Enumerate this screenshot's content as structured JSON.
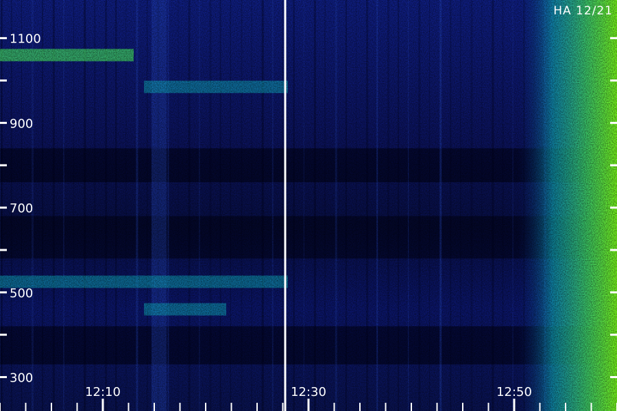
{
  "badge": "HA 12/21",
  "chart_data": {
    "type": "heatmap",
    "title": "",
    "xlabel": "",
    "ylabel": "",
    "x_ticks": [
      "12:10",
      "12:30",
      "12:50"
    ],
    "y_ticks": [
      300,
      500,
      700,
      900,
      1100
    ],
    "ylim": [
      220,
      1190
    ],
    "vertical_marker_time": "12:28",
    "colorscale": [
      "#000010",
      "#0a1f8a",
      "#2a52d8",
      "#11b6c8",
      "#44e16b",
      "#7bff1f"
    ],
    "description_bands": [
      {
        "y": 1060,
        "intensity": "high",
        "time_range": [
          "11:59",
          "12:13"
        ]
      },
      {
        "y": 985,
        "intensity": "medium",
        "time_range": [
          "12:14",
          "12:28"
        ]
      },
      {
        "y": 525,
        "intensity": "medium",
        "time_range": [
          "11:59",
          "12:28"
        ]
      },
      {
        "y": 460,
        "intensity": "medium",
        "time_range": [
          "12:14",
          "12:22"
        ]
      }
    ],
    "edge_emission": {
      "time_range": [
        "12:53",
        "12:58"
      ],
      "intensity": "very-high"
    }
  }
}
